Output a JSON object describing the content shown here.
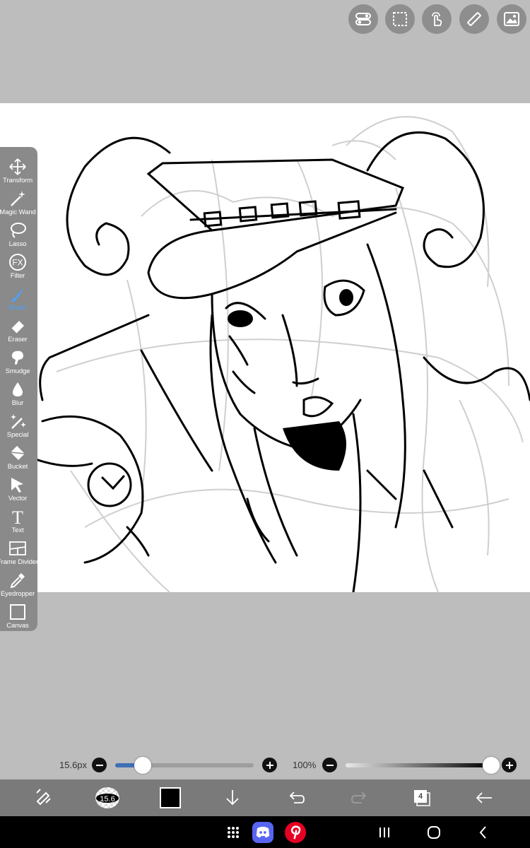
{
  "tools": [
    {
      "label": "Transform",
      "icon": "move-arrows-icon",
      "active": false
    },
    {
      "label": "Magic Wand",
      "icon": "magic-wand-icon",
      "active": false
    },
    {
      "label": "Lasso",
      "icon": "lasso-icon",
      "active": false
    },
    {
      "label": "Filter",
      "icon": "fx-icon",
      "active": false
    },
    {
      "label": "Brush",
      "icon": "brush-icon",
      "active": true
    },
    {
      "label": "Eraser",
      "icon": "eraser-icon",
      "active": false
    },
    {
      "label": "Smudge",
      "icon": "smudge-icon",
      "active": false
    },
    {
      "label": "Blur",
      "icon": "droplet-icon",
      "active": false
    },
    {
      "label": "Special",
      "icon": "sparkle-brush-icon",
      "active": false
    },
    {
      "label": "Bucket",
      "icon": "bucket-icon",
      "active": false
    },
    {
      "label": "Vector",
      "icon": "vector-arrow-icon",
      "active": false
    },
    {
      "label": "Text",
      "icon": "text-icon",
      "active": false
    },
    {
      "label": "Frame Divider",
      "icon": "frame-divider-icon",
      "active": false
    },
    {
      "label": "Eyedropper",
      "icon": "eyedropper-icon",
      "active": false
    },
    {
      "label": "Canvas",
      "icon": "canvas-icon",
      "active": false
    }
  ],
  "brush": {
    "size_label": "15.6px",
    "size_fraction": 0.2,
    "opacity_label": "100%",
    "opacity_fraction": 1.0,
    "preview_label": "15.6"
  },
  "layers": {
    "count": "4"
  },
  "colors": {
    "accent": "#4aa3ff",
    "slider_fill": "#3f6fb5",
    "current_color": "#000000",
    "toolbar_bg": "#7a7a7a",
    "background": "#bdbdbd"
  }
}
